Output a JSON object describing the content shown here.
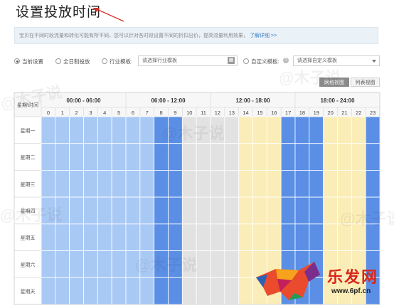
{
  "page": {
    "title": "设置投放时间"
  },
  "info": {
    "text": "宝贝在不同时段流量和转化可能有所不同，您可以针对各时段设置不同的折扣出价，提高流量利用效果，",
    "link": "了解详细 >>"
  },
  "options": {
    "current": "当前设置",
    "allday": "全日制投放",
    "industry": "行业模板:",
    "industry_placeholder": "请选择行业模板",
    "custom": "自定义模板:",
    "custom_placeholder": "请选择自定义模板",
    "selected": "current"
  },
  "view_buttons": {
    "grid": "网格视图",
    "list": "列表视图",
    "active": "grid"
  },
  "schedule": {
    "corner_label": "星期\\时间",
    "ranges": [
      "00:00 - 06:00",
      "06:00 - 12:00",
      "12:00 - 18:00",
      "18:00 - 24:00"
    ],
    "hours": [
      "0",
      "1",
      "2",
      "3",
      "4",
      "5",
      "6",
      "7",
      "8",
      "9",
      "10",
      "11",
      "12",
      "13",
      "14",
      "15",
      "16",
      "17",
      "18",
      "19",
      "20",
      "21",
      "22",
      "23"
    ],
    "days": [
      "星期一",
      "星期二",
      "星期三",
      "星期四",
      "星期五",
      "星期六",
      "星期天"
    ],
    "level_colors": {
      "1": "#a9c9f5",
      "2": "#e2e2e2",
      "3": "#fbedb7",
      "4": "#5b8fe6"
    },
    "rows": [
      [
        1,
        1,
        1,
        1,
        1,
        1,
        1,
        1,
        4,
        4,
        2,
        2,
        2,
        2,
        3,
        3,
        3,
        4,
        4,
        4,
        3,
        3,
        3,
        4
      ],
      [
        1,
        1,
        1,
        1,
        1,
        1,
        1,
        1,
        4,
        4,
        2,
        2,
        2,
        2,
        3,
        3,
        3,
        4,
        4,
        4,
        3,
        3,
        3,
        4
      ],
      [
        1,
        1,
        1,
        1,
        1,
        1,
        1,
        1,
        4,
        4,
        2,
        2,
        2,
        2,
        3,
        3,
        3,
        4,
        4,
        4,
        3,
        3,
        3,
        4
      ],
      [
        1,
        1,
        1,
        1,
        1,
        1,
        1,
        1,
        4,
        4,
        2,
        2,
        2,
        2,
        3,
        3,
        3,
        4,
        4,
        4,
        3,
        3,
        3,
        4
      ],
      [
        1,
        1,
        1,
        1,
        1,
        1,
        1,
        1,
        4,
        4,
        2,
        2,
        2,
        2,
        3,
        3,
        3,
        4,
        4,
        4,
        3,
        3,
        3,
        4
      ],
      [
        1,
        1,
        1,
        1,
        1,
        1,
        1,
        1,
        4,
        4,
        2,
        2,
        2,
        2,
        3,
        3,
        3,
        4,
        4,
        4,
        3,
        3,
        3,
        4
      ],
      [
        1,
        1,
        1,
        1,
        1,
        1,
        1,
        1,
        4,
        4,
        2,
        2,
        2,
        2,
        3,
        3,
        3,
        4,
        4,
        4,
        3,
        3,
        3,
        4
      ]
    ]
  },
  "watermark": {
    "text": "@木子说"
  },
  "brand": {
    "name": "乐发网",
    "url": "www.6pf.cn"
  }
}
